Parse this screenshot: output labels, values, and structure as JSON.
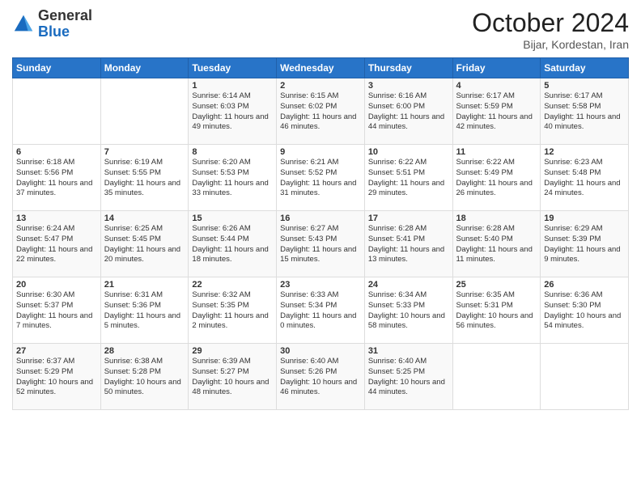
{
  "header": {
    "logo_general": "General",
    "logo_blue": "Blue",
    "month_title": "October 2024",
    "location": "Bijar, Kordestan, Iran"
  },
  "days_of_week": [
    "Sunday",
    "Monday",
    "Tuesday",
    "Wednesday",
    "Thursday",
    "Friday",
    "Saturday"
  ],
  "weeks": [
    [
      {
        "day": "",
        "info": ""
      },
      {
        "day": "",
        "info": ""
      },
      {
        "day": "1",
        "info": "Sunrise: 6:14 AM\nSunset: 6:03 PM\nDaylight: 11 hours and 49 minutes."
      },
      {
        "day": "2",
        "info": "Sunrise: 6:15 AM\nSunset: 6:02 PM\nDaylight: 11 hours and 46 minutes."
      },
      {
        "day": "3",
        "info": "Sunrise: 6:16 AM\nSunset: 6:00 PM\nDaylight: 11 hours and 44 minutes."
      },
      {
        "day": "4",
        "info": "Sunrise: 6:17 AM\nSunset: 5:59 PM\nDaylight: 11 hours and 42 minutes."
      },
      {
        "day": "5",
        "info": "Sunrise: 6:17 AM\nSunset: 5:58 PM\nDaylight: 11 hours and 40 minutes."
      }
    ],
    [
      {
        "day": "6",
        "info": "Sunrise: 6:18 AM\nSunset: 5:56 PM\nDaylight: 11 hours and 37 minutes."
      },
      {
        "day": "7",
        "info": "Sunrise: 6:19 AM\nSunset: 5:55 PM\nDaylight: 11 hours and 35 minutes."
      },
      {
        "day": "8",
        "info": "Sunrise: 6:20 AM\nSunset: 5:53 PM\nDaylight: 11 hours and 33 minutes."
      },
      {
        "day": "9",
        "info": "Sunrise: 6:21 AM\nSunset: 5:52 PM\nDaylight: 11 hours and 31 minutes."
      },
      {
        "day": "10",
        "info": "Sunrise: 6:22 AM\nSunset: 5:51 PM\nDaylight: 11 hours and 29 minutes."
      },
      {
        "day": "11",
        "info": "Sunrise: 6:22 AM\nSunset: 5:49 PM\nDaylight: 11 hours and 26 minutes."
      },
      {
        "day": "12",
        "info": "Sunrise: 6:23 AM\nSunset: 5:48 PM\nDaylight: 11 hours and 24 minutes."
      }
    ],
    [
      {
        "day": "13",
        "info": "Sunrise: 6:24 AM\nSunset: 5:47 PM\nDaylight: 11 hours and 22 minutes."
      },
      {
        "day": "14",
        "info": "Sunrise: 6:25 AM\nSunset: 5:45 PM\nDaylight: 11 hours and 20 minutes."
      },
      {
        "day": "15",
        "info": "Sunrise: 6:26 AM\nSunset: 5:44 PM\nDaylight: 11 hours and 18 minutes."
      },
      {
        "day": "16",
        "info": "Sunrise: 6:27 AM\nSunset: 5:43 PM\nDaylight: 11 hours and 15 minutes."
      },
      {
        "day": "17",
        "info": "Sunrise: 6:28 AM\nSunset: 5:41 PM\nDaylight: 11 hours and 13 minutes."
      },
      {
        "day": "18",
        "info": "Sunrise: 6:28 AM\nSunset: 5:40 PM\nDaylight: 11 hours and 11 minutes."
      },
      {
        "day": "19",
        "info": "Sunrise: 6:29 AM\nSunset: 5:39 PM\nDaylight: 11 hours and 9 minutes."
      }
    ],
    [
      {
        "day": "20",
        "info": "Sunrise: 6:30 AM\nSunset: 5:37 PM\nDaylight: 11 hours and 7 minutes."
      },
      {
        "day": "21",
        "info": "Sunrise: 6:31 AM\nSunset: 5:36 PM\nDaylight: 11 hours and 5 minutes."
      },
      {
        "day": "22",
        "info": "Sunrise: 6:32 AM\nSunset: 5:35 PM\nDaylight: 11 hours and 2 minutes."
      },
      {
        "day": "23",
        "info": "Sunrise: 6:33 AM\nSunset: 5:34 PM\nDaylight: 11 hours and 0 minutes."
      },
      {
        "day": "24",
        "info": "Sunrise: 6:34 AM\nSunset: 5:33 PM\nDaylight: 10 hours and 58 minutes."
      },
      {
        "day": "25",
        "info": "Sunrise: 6:35 AM\nSunset: 5:31 PM\nDaylight: 10 hours and 56 minutes."
      },
      {
        "day": "26",
        "info": "Sunrise: 6:36 AM\nSunset: 5:30 PM\nDaylight: 10 hours and 54 minutes."
      }
    ],
    [
      {
        "day": "27",
        "info": "Sunrise: 6:37 AM\nSunset: 5:29 PM\nDaylight: 10 hours and 52 minutes."
      },
      {
        "day": "28",
        "info": "Sunrise: 6:38 AM\nSunset: 5:28 PM\nDaylight: 10 hours and 50 minutes."
      },
      {
        "day": "29",
        "info": "Sunrise: 6:39 AM\nSunset: 5:27 PM\nDaylight: 10 hours and 48 minutes."
      },
      {
        "day": "30",
        "info": "Sunrise: 6:40 AM\nSunset: 5:26 PM\nDaylight: 10 hours and 46 minutes."
      },
      {
        "day": "31",
        "info": "Sunrise: 6:40 AM\nSunset: 5:25 PM\nDaylight: 10 hours and 44 minutes."
      },
      {
        "day": "",
        "info": ""
      },
      {
        "day": "",
        "info": ""
      }
    ]
  ]
}
